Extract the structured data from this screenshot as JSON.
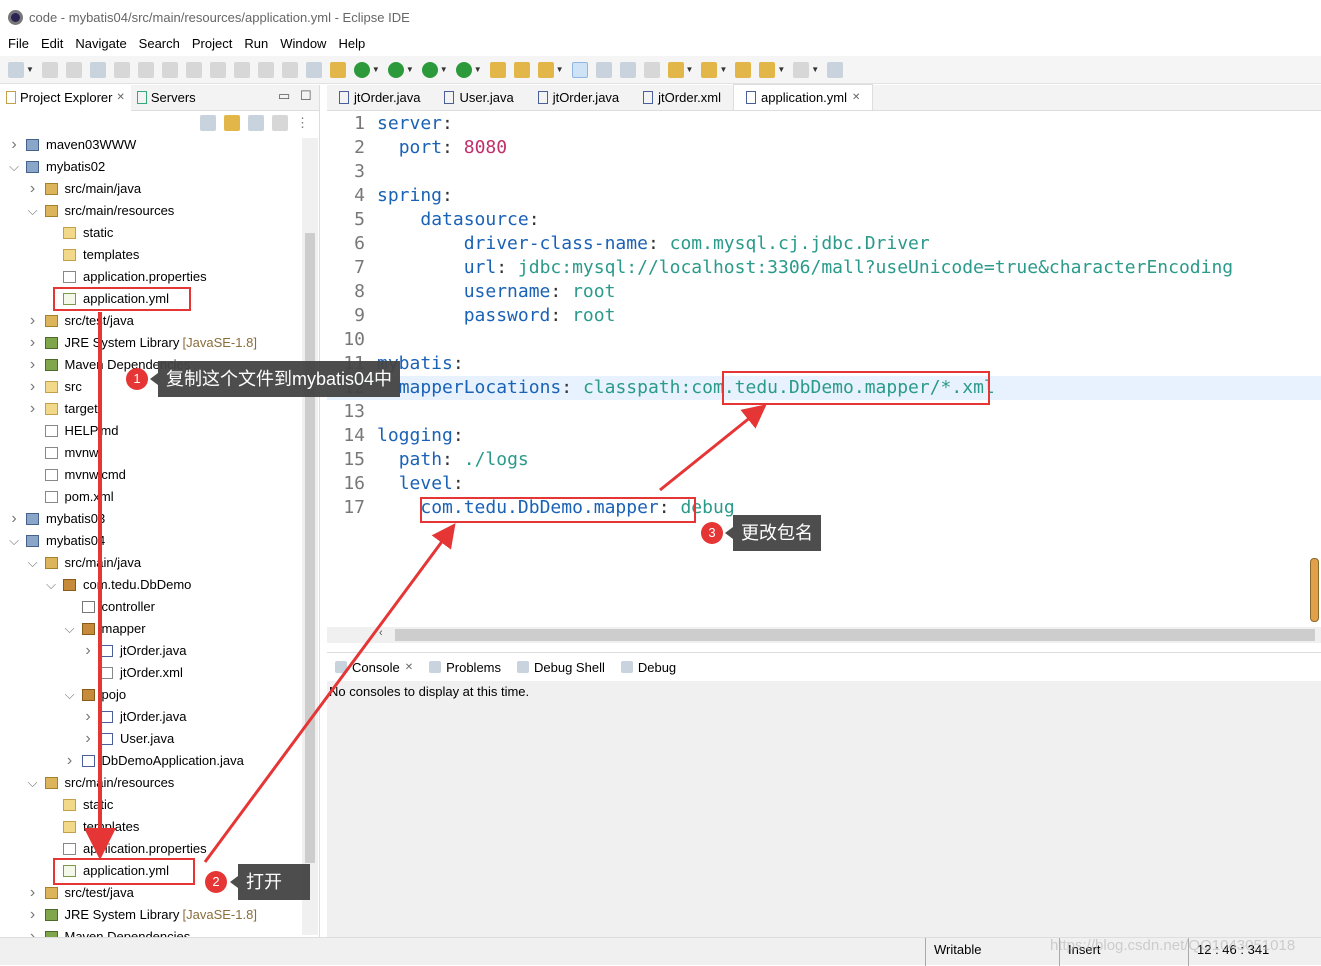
{
  "window": {
    "title": "code - mybatis04/src/main/resources/application.yml - Eclipse IDE"
  },
  "menu": [
    "File",
    "Edit",
    "Navigate",
    "Search",
    "Project",
    "Run",
    "Window",
    "Help"
  ],
  "left_panel": {
    "tabs": [
      {
        "label": "Project Explorer",
        "close": "✕"
      },
      {
        "label": "Servers"
      }
    ],
    "tree": [
      {
        "label": "maven03WWW",
        "level": 0,
        "arrow": "collapsed",
        "icon": "project"
      },
      {
        "label": "mybatis02",
        "level": 0,
        "arrow": "expanded",
        "icon": "project"
      },
      {
        "label": "src/main/java",
        "level": 1,
        "arrow": "collapsed",
        "icon": "source-folder"
      },
      {
        "label": "src/main/resources",
        "level": 1,
        "arrow": "expanded",
        "icon": "source-folder"
      },
      {
        "label": "static",
        "level": 2,
        "icon": "folder"
      },
      {
        "label": "templates",
        "level": 2,
        "icon": "folder"
      },
      {
        "label": "application.properties",
        "level": 2,
        "icon": "file"
      },
      {
        "label": "application.yml",
        "level": 2,
        "icon": "yml"
      },
      {
        "label": "src/test/java",
        "level": 1,
        "arrow": "collapsed",
        "icon": "source-folder"
      },
      {
        "label": "JRE System Library",
        "suffix": "[JavaSE-1.8]",
        "level": 1,
        "arrow": "collapsed",
        "icon": "library"
      },
      {
        "label": "Maven Dependencies",
        "level": 1,
        "arrow": "collapsed",
        "icon": "library"
      },
      {
        "label": "src",
        "level": 1,
        "arrow": "collapsed",
        "icon": "folder"
      },
      {
        "label": "target",
        "level": 1,
        "arrow": "collapsed",
        "icon": "folder"
      },
      {
        "label": "HELP.md",
        "level": 1,
        "icon": "file"
      },
      {
        "label": "mvnw",
        "level": 1,
        "icon": "file"
      },
      {
        "label": "mvnw.cmd",
        "level": 1,
        "icon": "file"
      },
      {
        "label": "pom.xml",
        "level": 1,
        "icon": "file"
      },
      {
        "label": "mybatis03",
        "level": 0,
        "arrow": "collapsed",
        "icon": "project"
      },
      {
        "label": "mybatis04",
        "level": 0,
        "arrow": "expanded",
        "icon": "project"
      },
      {
        "label": "src/main/java",
        "level": 1,
        "arrow": "expanded",
        "icon": "source-folder"
      },
      {
        "label": "com.tedu.DbDemo",
        "level": 2,
        "arrow": "expanded",
        "icon": "package"
      },
      {
        "label": "controller",
        "level": 3,
        "icon": "package-empty"
      },
      {
        "label": "mapper",
        "level": 3,
        "arrow": "expanded",
        "icon": "package"
      },
      {
        "label": "jtOrder.java",
        "level": 4,
        "arrow": "collapsed",
        "icon": "java"
      },
      {
        "label": "jtOrder.xml",
        "level": 4,
        "icon": "file"
      },
      {
        "label": "pojo",
        "level": 3,
        "arrow": "expanded",
        "icon": "package"
      },
      {
        "label": "jtOrder.java",
        "level": 4,
        "arrow": "collapsed",
        "icon": "java"
      },
      {
        "label": "User.java",
        "level": 4,
        "arrow": "collapsed",
        "icon": "java"
      },
      {
        "label": "DbDemoApplication.java",
        "level": 3,
        "arrow": "collapsed",
        "icon": "java"
      },
      {
        "label": "src/main/resources",
        "level": 1,
        "arrow": "expanded",
        "icon": "source-folder"
      },
      {
        "label": "static",
        "level": 2,
        "icon": "folder"
      },
      {
        "label": "templates",
        "level": 2,
        "icon": "folder"
      },
      {
        "label": "application.properties",
        "level": 2,
        "icon": "file"
      },
      {
        "label": "application.yml",
        "level": 2,
        "icon": "yml"
      },
      {
        "label": "src/test/java",
        "level": 1,
        "arrow": "collapsed",
        "icon": "source-folder"
      },
      {
        "label": "JRE System Library",
        "suffix": "[JavaSE-1.8]",
        "level": 1,
        "arrow": "collapsed",
        "icon": "library"
      },
      {
        "label": "Maven Dependencies",
        "level": 1,
        "arrow": "collapsed",
        "icon": "library"
      }
    ]
  },
  "editor": {
    "tabs": [
      {
        "label": "jtOrder.java"
      },
      {
        "label": "User.java"
      },
      {
        "label": "jtOrder.java"
      },
      {
        "label": "jtOrder.xml"
      },
      {
        "label": "application.yml",
        "active": true,
        "close": "✕"
      }
    ],
    "lines": [
      {
        "n": "1",
        "indent": "",
        "key": "server",
        "sep": ":",
        "val": ""
      },
      {
        "n": "2",
        "indent": "  ",
        "key": "port",
        "sep": ": ",
        "val": "8080",
        "num": true
      },
      {
        "n": "3",
        "indent": "",
        "key": "",
        "sep": "",
        "val": ""
      },
      {
        "n": "4",
        "indent": "",
        "key": "spring",
        "sep": ":",
        "val": ""
      },
      {
        "n": "5",
        "indent": "    ",
        "key": "datasource",
        "sep": ":",
        "val": ""
      },
      {
        "n": "6",
        "indent": "        ",
        "key": "driver-class-name",
        "sep": ": ",
        "val": "com.mysql.cj.jdbc.Driver"
      },
      {
        "n": "7",
        "indent": "        ",
        "key": "url",
        "sep": ": ",
        "val": "jdbc:mysql://localhost:3306/mall?useUnicode=true&characterEncoding"
      },
      {
        "n": "8",
        "indent": "        ",
        "key": "username",
        "sep": ": ",
        "val": "root"
      },
      {
        "n": "9",
        "indent": "        ",
        "key": "password",
        "sep": ": ",
        "val": "root"
      },
      {
        "n": "10",
        "indent": "",
        "key": "",
        "sep": "",
        "val": ""
      },
      {
        "n": "11",
        "indent": "",
        "key": "mybatis",
        "sep": ":",
        "val": ""
      },
      {
        "n": "12",
        "indent": "  ",
        "key": "mapperLocations",
        "sep": ": ",
        "val": "classpath:com.tedu.DbDemo.mapper/*.xml",
        "highlight": true
      },
      {
        "n": "13",
        "indent": "",
        "key": "",
        "sep": "",
        "val": ""
      },
      {
        "n": "14",
        "indent": "",
        "key": "logging",
        "sep": ":",
        "val": ""
      },
      {
        "n": "15",
        "indent": "  ",
        "key": "path",
        "sep": ": ",
        "val": "./logs"
      },
      {
        "n": "16",
        "indent": "  ",
        "key": "level",
        "sep": ":",
        "val": ""
      },
      {
        "n": "17",
        "indent": "    ",
        "key": "com.tedu.DbDemo.mapper",
        "sep": ": ",
        "val": "debug"
      }
    ]
  },
  "console": {
    "tabs": [
      {
        "label": "Console",
        "close": "✕"
      },
      {
        "label": "Problems"
      },
      {
        "label": "Debug Shell"
      },
      {
        "label": "Debug"
      }
    ],
    "message": "No consoles to display at this time."
  },
  "status": {
    "mode": "Writable",
    "insert": "Insert",
    "position": "12 : 46 : 341"
  },
  "annotations": [
    {
      "number": "1",
      "text": "复制这个文件到mybatis04中"
    },
    {
      "number": "2",
      "text": "打开"
    },
    {
      "number": "3",
      "text": "更改包名"
    }
  ],
  "watermark": "https://blog.csdn.net/QQ1043051018",
  "colors": {
    "annotation": "#e53535",
    "yaml_key": "#1a62b5",
    "yaml_value": "#2a9a8a",
    "yaml_number": "#c0306a"
  }
}
